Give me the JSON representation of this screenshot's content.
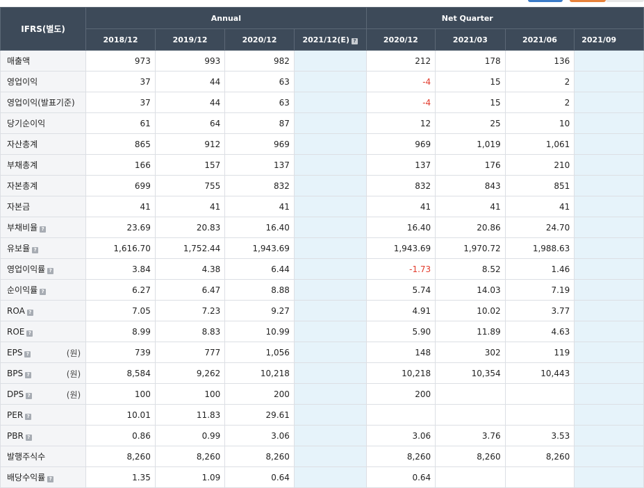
{
  "header": {
    "corner": "IFRS(별도)",
    "group_annual": "Annual",
    "group_quarter": "Net Quarter",
    "periods": [
      "2018/12",
      "2019/12",
      "2020/12",
      "2021/12(E)",
      "2020/12",
      "2021/03",
      "2021/06",
      "2021/09"
    ],
    "estimate_help_icon": "question-icon"
  },
  "rows": [
    {
      "label": "매출액",
      "help": false,
      "unit": "",
      "values": [
        "973",
        "993",
        "982",
        "",
        "212",
        "178",
        "136",
        ""
      ]
    },
    {
      "label": "영업이익",
      "help": false,
      "unit": "",
      "values": [
        "37",
        "44",
        "63",
        "",
        "-4",
        "15",
        "2",
        ""
      ]
    },
    {
      "label": "영업이익(발표기준)",
      "help": false,
      "unit": "",
      "values": [
        "37",
        "44",
        "63",
        "",
        "-4",
        "15",
        "2",
        ""
      ]
    },
    {
      "label": "당기순이익",
      "help": false,
      "unit": "",
      "values": [
        "61",
        "64",
        "87",
        "",
        "12",
        "25",
        "10",
        ""
      ]
    },
    {
      "label": "자산총계",
      "help": false,
      "unit": "",
      "values": [
        "865",
        "912",
        "969",
        "",
        "969",
        "1,019",
        "1,061",
        ""
      ]
    },
    {
      "label": "부채총계",
      "help": false,
      "unit": "",
      "values": [
        "166",
        "157",
        "137",
        "",
        "137",
        "176",
        "210",
        ""
      ]
    },
    {
      "label": "자본총계",
      "help": false,
      "unit": "",
      "values": [
        "699",
        "755",
        "832",
        "",
        "832",
        "843",
        "851",
        ""
      ]
    },
    {
      "label": "자본금",
      "help": false,
      "unit": "",
      "values": [
        "41",
        "41",
        "41",
        "",
        "41",
        "41",
        "41",
        ""
      ]
    },
    {
      "label": "부채비율",
      "help": true,
      "unit": "",
      "values": [
        "23.69",
        "20.83",
        "16.40",
        "",
        "16.40",
        "20.86",
        "24.70",
        ""
      ]
    },
    {
      "label": "유보율",
      "help": true,
      "unit": "",
      "values": [
        "1,616.70",
        "1,752.44",
        "1,943.69",
        "",
        "1,943.69",
        "1,970.72",
        "1,988.63",
        ""
      ]
    },
    {
      "label": "영업이익률",
      "help": true,
      "unit": "",
      "values": [
        "3.84",
        "4.38",
        "6.44",
        "",
        "-1.73",
        "8.52",
        "1.46",
        ""
      ]
    },
    {
      "label": "순이익률",
      "help": true,
      "unit": "",
      "values": [
        "6.27",
        "6.47",
        "8.88",
        "",
        "5.74",
        "14.03",
        "7.19",
        ""
      ]
    },
    {
      "label": "ROA",
      "help": true,
      "unit": "",
      "values": [
        "7.05",
        "7.23",
        "9.27",
        "",
        "4.91",
        "10.02",
        "3.77",
        ""
      ]
    },
    {
      "label": "ROE",
      "help": true,
      "unit": "",
      "values": [
        "8.99",
        "8.83",
        "10.99",
        "",
        "5.90",
        "11.89",
        "4.63",
        ""
      ]
    },
    {
      "label": "EPS",
      "help": true,
      "unit": "(원)",
      "values": [
        "739",
        "777",
        "1,056",
        "",
        "148",
        "302",
        "119",
        ""
      ]
    },
    {
      "label": "BPS",
      "help": true,
      "unit": "(원)",
      "values": [
        "8,584",
        "9,262",
        "10,218",
        "",
        "10,218",
        "10,354",
        "10,443",
        ""
      ]
    },
    {
      "label": "DPS",
      "help": true,
      "unit": "(원)",
      "values": [
        "100",
        "100",
        "200",
        "",
        "200",
        "",
        "",
        ""
      ]
    },
    {
      "label": "PER",
      "help": true,
      "unit": "",
      "values": [
        "10.01",
        "11.83",
        "29.61",
        "",
        "",
        "",
        "",
        ""
      ]
    },
    {
      "label": "PBR",
      "help": true,
      "unit": "",
      "values": [
        "0.86",
        "0.99",
        "3.06",
        "",
        "3.06",
        "3.76",
        "3.53",
        ""
      ]
    },
    {
      "label": "발행주식수",
      "help": false,
      "unit": "",
      "values": [
        "8,260",
        "8,260",
        "8,260",
        "",
        "8,260",
        "8,260",
        "8,260",
        ""
      ]
    },
    {
      "label": "배당수익률",
      "help": true,
      "unit": "",
      "values": [
        "1.35",
        "1.09",
        "0.64",
        "",
        "0.64",
        "",
        "",
        ""
      ]
    }
  ],
  "colors": {
    "header_bg": "#3d4a59",
    "label_bg": "#f4f5f7",
    "estimate_bg": "#e6f3fa",
    "negative_text": "#e23a2b"
  }
}
